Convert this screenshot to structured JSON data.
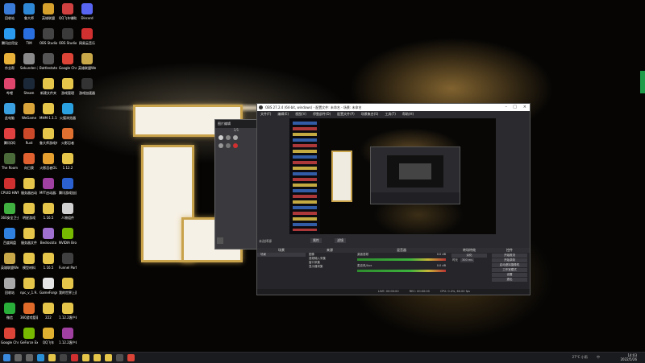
{
  "desktop_icons": [
    {
      "label": "回收站",
      "color": "#3b7bd8",
      "col": 0,
      "row": 0
    },
    {
      "label": "鲁大师",
      "color": "#2f88d6",
      "col": 1,
      "row": 0
    },
    {
      "label": "英雄联盟",
      "color": "#d5a12c",
      "col": 2,
      "row": 0
    },
    {
      "label": "QQ飞车辅助工具",
      "color": "#d04040",
      "col": 3,
      "row": 0
    },
    {
      "label": "Discord",
      "color": "#5865f2",
      "col": 4,
      "row": 0
    },
    {
      "label": "腾讯应用宝",
      "color": "#2b9bf0",
      "col": 0,
      "row": 1
    },
    {
      "label": "TIM",
      "color": "#2a6fe0",
      "col": 1,
      "row": 1
    },
    {
      "label": "OBS Studio",
      "color": "#444444",
      "col": 2,
      "row": 1
    },
    {
      "label": "OBS Studio",
      "color": "#3a3a3a",
      "col": 3,
      "row": 1
    },
    {
      "label": "网易云音乐",
      "color": "#d03030",
      "col": 4,
      "row": 1
    },
    {
      "label": "作业帮",
      "color": "#e8b23a",
      "col": 0,
      "row": 2
    },
    {
      "label": "Sekunden 游戏",
      "color": "#8a8a8a",
      "col": 1,
      "row": 2
    },
    {
      "label": "Battlestate Games L...",
      "color": "#555555",
      "col": 2,
      "row": 2
    },
    {
      "label": "Google Chrome",
      "color": "#db4437",
      "col": 3,
      "row": 2
    },
    {
      "label": "英雄联盟WeGame",
      "color": "#c9a84a",
      "col": 4,
      "row": 2
    },
    {
      "label": "哔哩",
      "color": "#e0456d",
      "col": 0,
      "row": 3
    },
    {
      "label": "Steam",
      "color": "#1b2838",
      "col": 1,
      "row": 3
    },
    {
      "label": "新建文件夹",
      "color": "#e5c64a",
      "col": 2,
      "row": 3
    },
    {
      "label": "游戏管理",
      "color": "#e5c64a",
      "col": 3,
      "row": 3
    },
    {
      "label": "游戏加速器",
      "color": "#333333",
      "col": 4,
      "row": 3
    },
    {
      "label": "此电脑",
      "color": "#3aa0e0",
      "col": 0,
      "row": 4
    },
    {
      "label": "WeGame",
      "color": "#d9a43a",
      "col": 1,
      "row": 4
    },
    {
      "label": "MHM-1.1.1...",
      "color": "#e5c64a",
      "col": 2,
      "row": 4
    },
    {
      "label": "火狐浏览器",
      "color": "#2aa0e0",
      "col": 3,
      "row": 4
    },
    {
      "label": "腾讯QQ",
      "color": "#e04040",
      "col": 0,
      "row": 5
    },
    {
      "label": "Rust",
      "color": "#cc4a2a",
      "col": 1,
      "row": 5
    },
    {
      "label": "鲁大师游戏库",
      "color": "#e5c64a",
      "col": 2,
      "row": 5
    },
    {
      "label": "火影忍者",
      "color": "#e07030",
      "col": 3,
      "row": 5
    },
    {
      "label": "The Room",
      "color": "#4a6a3a",
      "col": 0,
      "row": 6
    },
    {
      "label": "向日葵",
      "color": "#e06030",
      "col": 1,
      "row": 6
    },
    {
      "label": "火影忍者OL",
      "color": "#e5a030",
      "col": 2,
      "row": 6
    },
    {
      "label": "1.12.2",
      "color": "#e5c64a",
      "col": 3,
      "row": 6
    },
    {
      "label": "CPUID HWMonitor",
      "color": "#d03030",
      "col": 0,
      "row": 7
    },
    {
      "label": "服务器启动",
      "color": "#e5c64a",
      "col": 1,
      "row": 7
    },
    {
      "label": "MFT启动器.1.6.zip",
      "color": "#a040a0",
      "col": 2,
      "row": 7
    },
    {
      "label": "腾讯游戏加速",
      "color": "#2a60d0",
      "col": 3,
      "row": 7
    },
    {
      "label": "360安全卫士",
      "color": "#40b040",
      "col": 0,
      "row": 8
    },
    {
      "label": "明星游戏",
      "color": "#e5c64a",
      "col": 1,
      "row": 8
    },
    {
      "label": "1.16.5",
      "color": "#e5c64a",
      "col": 2,
      "row": 8
    },
    {
      "label": "人物组件",
      "color": "#d0d0d0",
      "col": 3,
      "row": 8
    },
    {
      "label": "百度网盘",
      "color": "#3080e0",
      "col": 0,
      "row": 9
    },
    {
      "label": "服务器文件",
      "color": "#e5c64a",
      "col": 1,
      "row": 9
    },
    {
      "label": "Bedrockto",
      "color": "#a070d0",
      "col": 2,
      "row": 9
    },
    {
      "label": "NVIDIA Broadcast",
      "color": "#76b900",
      "col": 3,
      "row": 9
    },
    {
      "label": "英雄联盟WeGame版",
      "color": "#c9a84a",
      "col": 0,
      "row": 10
    },
    {
      "label": "模型材料",
      "color": "#e5c64a",
      "col": 1,
      "row": 10
    },
    {
      "label": "1.16.5",
      "color": "#e5c64a",
      "col": 2,
      "row": 10
    },
    {
      "label": "Funnel Party",
      "color": "#404040",
      "col": 3,
      "row": 10
    },
    {
      "label": "回收站",
      "color": "#aaaaaa",
      "col": 0,
      "row": 11
    },
    {
      "label": "npc_v_1.9...",
      "color": "#e5c64a",
      "col": 1,
      "row": 11
    },
    {
      "label": "GameForge",
      "color": "#e5e5e5",
      "col": 2,
      "row": 11
    },
    {
      "label": "我的世界上面程序",
      "color": "#e5c64a",
      "col": 3,
      "row": 11
    },
    {
      "label": "微信",
      "color": "#2aae3a",
      "col": 0,
      "row": 12
    },
    {
      "label": "360游戏管家",
      "color": "#e06a2a",
      "col": 1,
      "row": 12
    },
    {
      "label": "222",
      "color": "#e5c64a",
      "col": 2,
      "row": 12
    },
    {
      "label": "1.12.2客户端",
      "color": "#e5c64a",
      "col": 3,
      "row": 12
    },
    {
      "label": "Google Chrome",
      "color": "#db4437",
      "col": 0,
      "row": 13
    },
    {
      "label": "GeForce Experience",
      "color": "#76b900",
      "col": 1,
      "row": 13
    },
    {
      "label": "QQ飞车",
      "color": "#e0b030",
      "col": 2,
      "row": 13
    },
    {
      "label": "1.12.2客户端.rar",
      "color": "#a040a0",
      "col": 3,
      "row": 13
    }
  ],
  "obs": {
    "title": "OBS 27.2.4 (64-bit, windows) - 配置文件: 未命名 - 场景: 未命名",
    "menu": [
      "文件(F)",
      "编辑(E)",
      "视图(V)",
      "停靠部件(D)",
      "配置文件(P)",
      "场景集合(S)",
      "工具(T)",
      "帮助(H)"
    ],
    "no_source_label": "未选择源",
    "properties_label": "属性",
    "filters_label": "滤镜",
    "panels": {
      "scenes": {
        "title": "场景",
        "items": [
          "场景"
        ]
      },
      "sources": {
        "title": "来源",
        "items": [
          "图像",
          "音频输入采集",
          "窗口采集",
          "显示器采集"
        ]
      },
      "mixer": {
        "title": "混音器",
        "channels": [
          {
            "name": "桌面音频",
            "level": "0.0 dB"
          },
          {
            "name": "麦克风/Aux",
            "level": "0.0 dB"
          }
        ]
      },
      "transitions": {
        "title": "转场特效",
        "type": "淡化",
        "duration_label": "时长",
        "duration": "300 ms"
      },
      "controls": {
        "title": "控件",
        "buttons": [
          "开始推流",
          "开始录制",
          "启动虚拟摄像机",
          "工作室模式",
          "设置",
          "退出"
        ]
      }
    },
    "status": {
      "live": "LIVE: 00:00:00",
      "rec": "REC: 00:00:00",
      "cpu": "CPU: 0.4%, 60.00 fps"
    }
  },
  "editor": {
    "title": "图片编辑",
    "page": "1/1"
  },
  "taskbar": {
    "icons": [
      {
        "name": "windows-start-icon",
        "color": "#3a8ae0"
      },
      {
        "name": "search-icon",
        "color": "#666666"
      },
      {
        "name": "task-view-icon",
        "color": "#666666"
      },
      {
        "name": "edge-icon",
        "color": "#2a90d8"
      },
      {
        "name": "file-explorer-icon",
        "color": "#e5c64a"
      },
      {
        "name": "obs-taskbar-icon",
        "color": "#444444"
      },
      {
        "name": "netease-music-icon",
        "color": "#d03030"
      },
      {
        "name": "folder-icon",
        "color": "#e5c64a"
      },
      {
        "name": "folder-icon",
        "color": "#e5c64a"
      },
      {
        "name": "folder-icon",
        "color": "#e5c64a"
      },
      {
        "name": "obs-taskbar-icon",
        "color": "#505050"
      },
      {
        "name": "chrome-taskbar-icon",
        "color": "#db4437"
      }
    ],
    "time": "14:03",
    "date": "2022/5/26",
    "weather": "27°C 小雨",
    "ime": "中"
  }
}
